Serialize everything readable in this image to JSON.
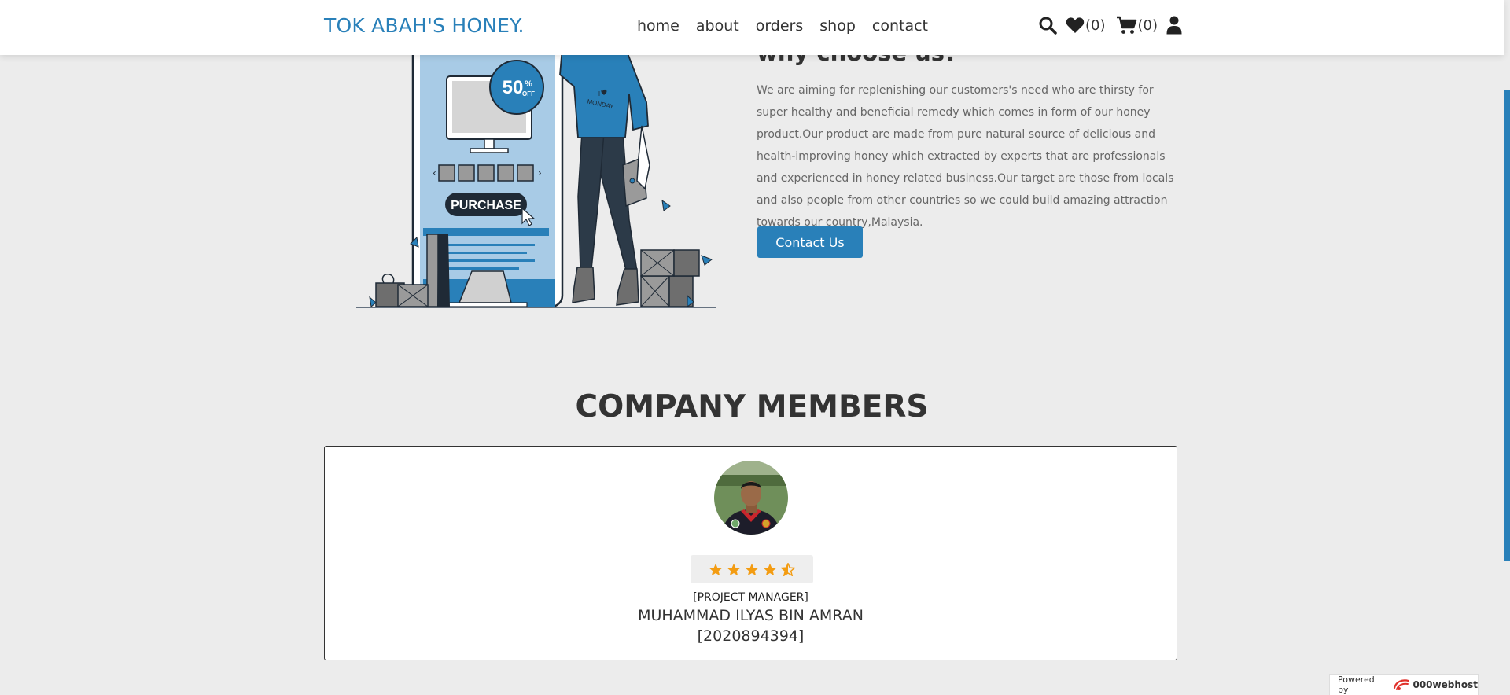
{
  "header": {
    "logo": "TOK ABAH'S HONEY.",
    "nav": [
      "home",
      "about",
      "orders",
      "shop",
      "contact"
    ],
    "wishlist_count": "(0)",
    "cart_count": "(0)",
    "icons": [
      "search-icon",
      "heart-icon",
      "cart-icon",
      "user-icon"
    ]
  },
  "about": {
    "title": "why choose us?",
    "paragraph": "We are aiming for replenishing our customers's need who are thirsty for super healthy and beneficial remedy which comes in form of our honey product.Our product are made from pure natural source of delicious and health-improving honey which extracted by experts that are professionals and experienced in honey related business.Our target are those from locals and also people from other countries so we could build amazing attraction towards our country,Malaysia.",
    "button": "Contact Us",
    "illustration": {
      "discount_line1": "50",
      "discount_pct": "%",
      "discount_line2": "OFF",
      "purchase_label": "PURCHASE",
      "shirt_line1": "I",
      "shirt_line2": "MONDAY"
    }
  },
  "members": {
    "heading": "COMPANY MEMBERS",
    "items": [
      {
        "role": "[PROJECT MANAGER]",
        "name": "MUHAMMAD ILYAS BIN AMRAN",
        "id": "[2020894394]",
        "rating": 4.5
      }
    ]
  },
  "footer": {
    "powered_by": "Powered by",
    "brand": "000webhost"
  },
  "colors": {
    "accent": "#2980b9",
    "background": "#ececec",
    "star": "#f39c12"
  }
}
